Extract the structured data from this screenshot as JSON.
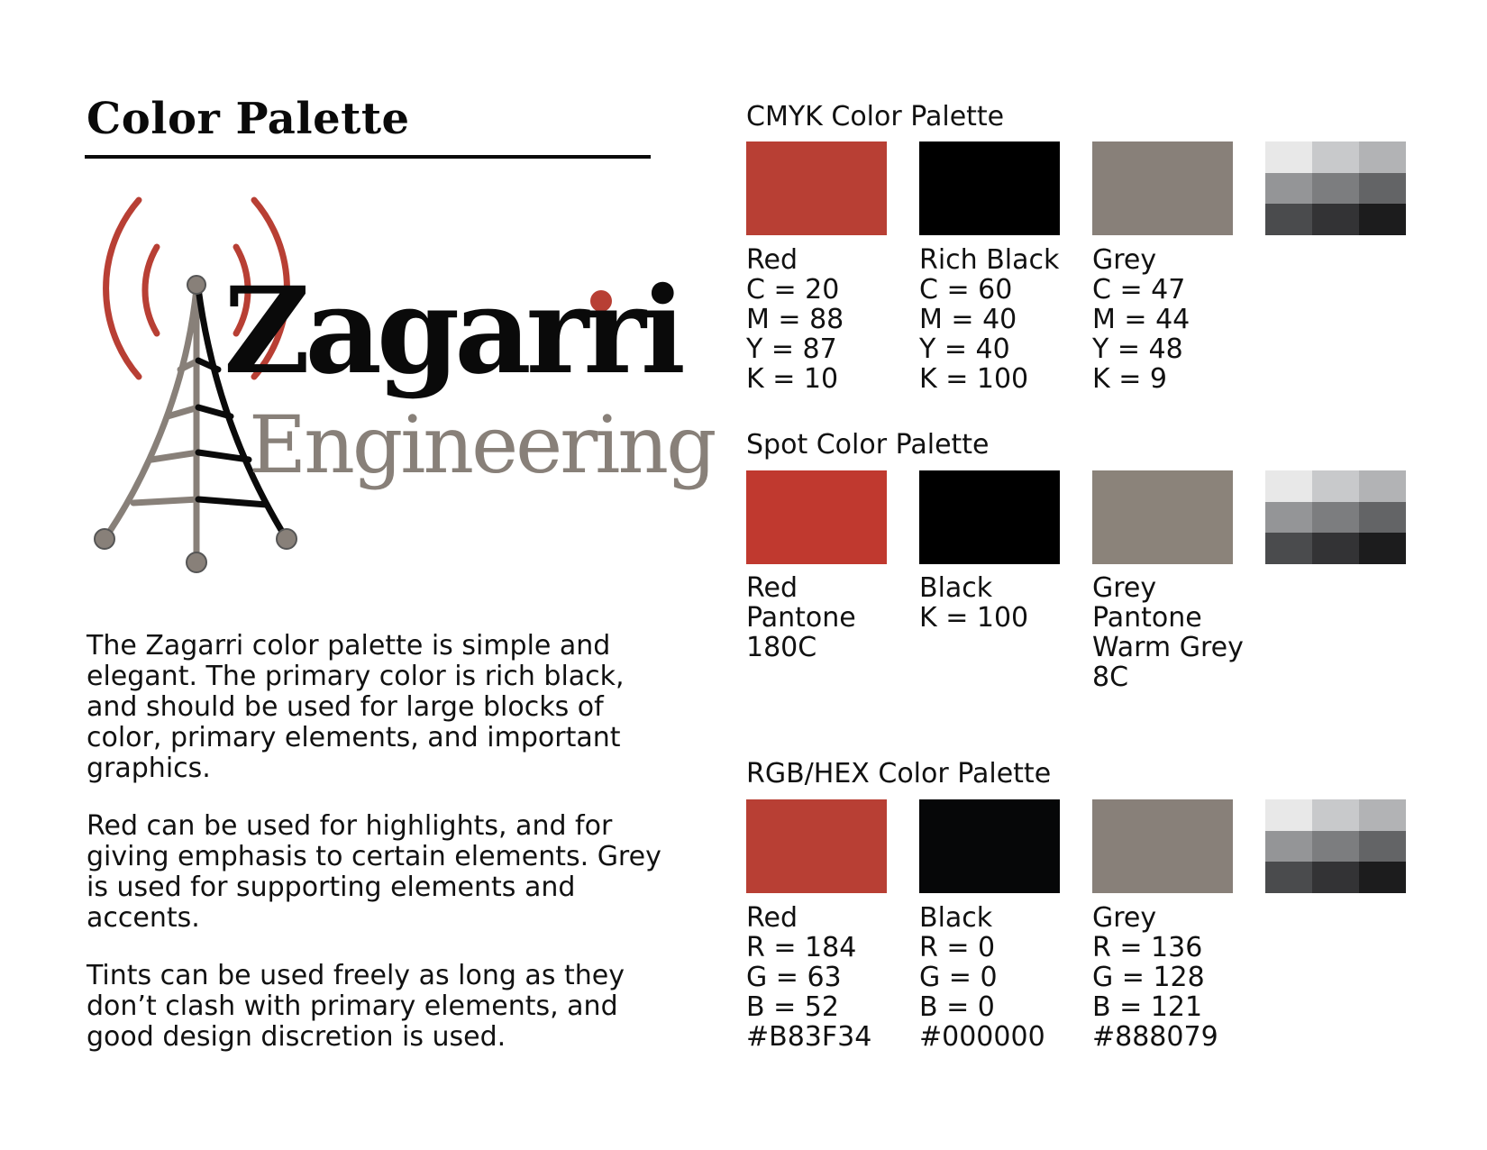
{
  "page": {
    "title": "Color Palette"
  },
  "logo": {
    "word1": "Zagarri",
    "word2": "Engineering",
    "colors": {
      "red": "#B83F34",
      "black": "#0a0a0a",
      "grey": "#888079"
    }
  },
  "description": [
    "The Zagarri color palette is simple and elegant. The primary color is rich black, and should be used for large blocks of color, primary elements, and important graphics.",
    "Red can be used for highlights, and for giving emphasis to certain elements. Grey is used for supporting elements and accents.",
    "Tints can be used freely as long as they don’t clash with primary elements, and good design discretion is used."
  ],
  "tints": [
    "#e8e8e8",
    "#c8c9cb",
    "#b2b3b5",
    "#949597",
    "#7c7d7f",
    "#636466",
    "#4a4b4d",
    "#333335",
    "#1c1c1d"
  ],
  "palettes": {
    "cmyk": {
      "title": "CMYK Color Palette",
      "swatches": [
        {
          "color": "#B83F34",
          "lines": [
            "Red",
            "C = 20",
            "M = 88",
            "Y = 87",
            "K = 10"
          ]
        },
        {
          "color": "#000000",
          "lines": [
            "Rich Black",
            "C = 60",
            "M = 40",
            "Y = 40",
            "K = 100"
          ]
        },
        {
          "color": "#888079",
          "lines": [
            "Grey",
            "C = 47",
            "M = 44",
            "Y = 48",
            "K = 9"
          ]
        }
      ]
    },
    "spot": {
      "title": "Spot Color Palette",
      "swatches": [
        {
          "color": "#C0392F",
          "lines": [
            "Red",
            "Pantone",
            "180C"
          ]
        },
        {
          "color": "#000000",
          "lines": [
            "Black",
            "K = 100"
          ]
        },
        {
          "color": "#8B837A",
          "lines": [
            "Grey",
            "Pantone",
            "Warm Grey",
            "8C"
          ]
        }
      ]
    },
    "rgb": {
      "title": "RGB/HEX Color Palette",
      "swatches": [
        {
          "color": "#B83F34",
          "lines": [
            "Red",
            "R = 184",
            "G = 63",
            "B = 52",
            "#B83F34"
          ]
        },
        {
          "color": "#060708",
          "lines": [
            "Black",
            "R = 0",
            "G = 0",
            "B = 0",
            "#000000"
          ]
        },
        {
          "color": "#888079",
          "lines": [
            "Grey",
            "R = 136",
            "G = 128",
            "B = 121",
            "#888079"
          ]
        }
      ]
    }
  }
}
